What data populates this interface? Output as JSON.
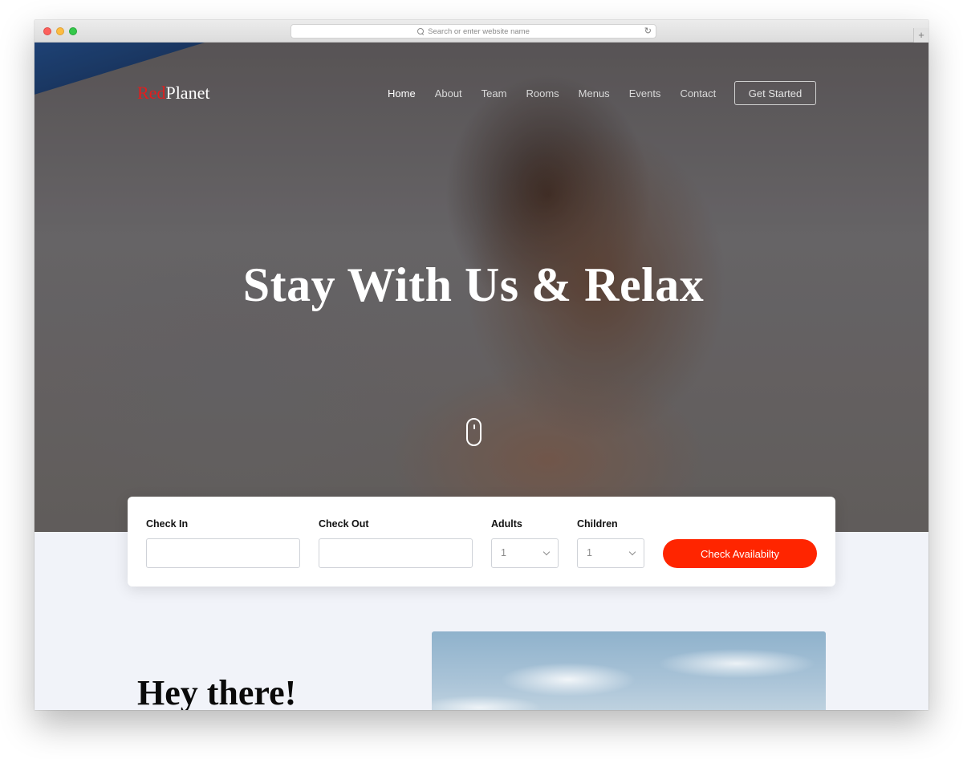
{
  "browser": {
    "url_placeholder": "Search or enter website name",
    "reload_glyph": "↻",
    "new_tab_glyph": "+"
  },
  "site": {
    "brand_red": "Red",
    "brand_white": "Planet",
    "accent_color": "#ff2500"
  },
  "nav": {
    "items": [
      {
        "label": "Home",
        "active": true
      },
      {
        "label": "About"
      },
      {
        "label": "Team"
      },
      {
        "label": "Rooms"
      },
      {
        "label": "Menus"
      },
      {
        "label": "Events"
      },
      {
        "label": "Contact"
      }
    ],
    "cta_label": "Get Started"
  },
  "hero": {
    "title": "Stay With Us & Relax",
    "scroll_icon": "mouse-icon"
  },
  "booking": {
    "check_in_label": "Check In",
    "check_in_value": "",
    "check_out_label": "Check Out",
    "check_out_value": "",
    "adults_label": "Adults",
    "adults_value": "1",
    "children_label": "Children",
    "children_value": "1",
    "submit_label": "Check Availabilty"
  },
  "intro": {
    "title": "Hey there!"
  }
}
